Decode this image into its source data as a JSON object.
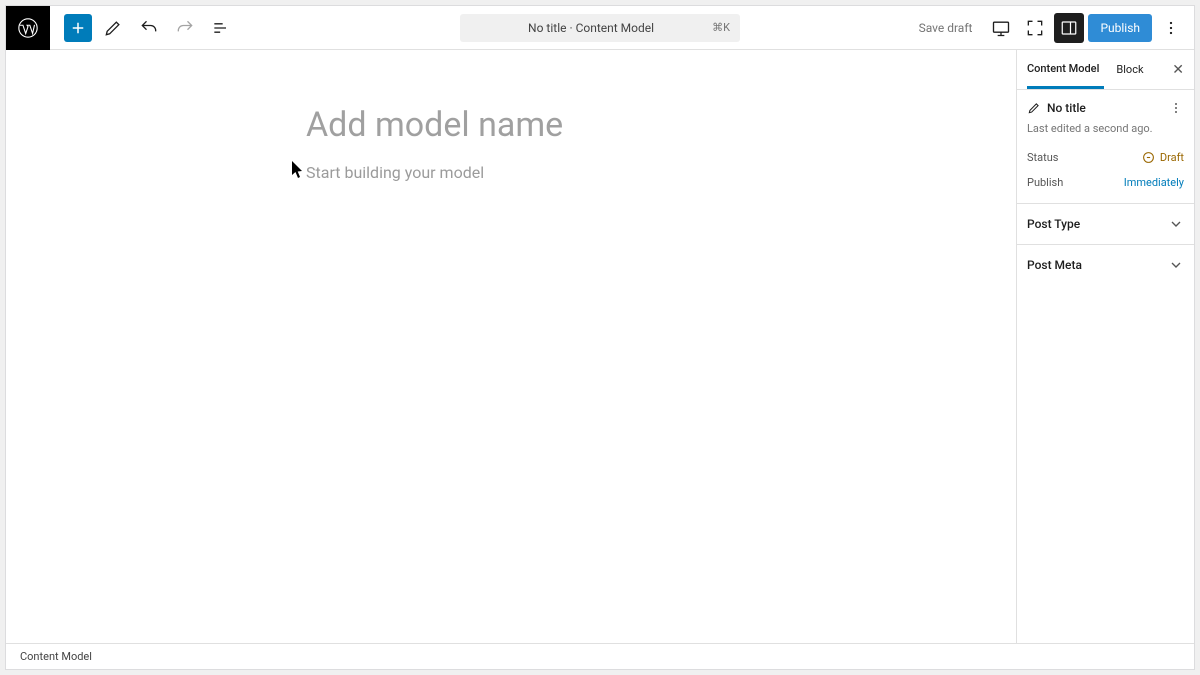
{
  "topbar": {
    "center_title": "No title · Content Model",
    "center_kbd": "⌘K",
    "save_draft": "Save draft",
    "publish": "Publish"
  },
  "editor": {
    "title_placeholder": "Add model name",
    "body_placeholder": "Start building your model"
  },
  "sidebar": {
    "tabs": {
      "content_model": "Content Model",
      "block": "Block"
    },
    "doc_title": "No title",
    "last_edited": "Last edited a second ago.",
    "status_label": "Status",
    "status_value": "Draft",
    "publish_label": "Publish",
    "publish_value": "Immediately",
    "sections": {
      "post_type": "Post Type",
      "post_meta": "Post Meta"
    }
  },
  "footer": {
    "breadcrumb": "Content Model"
  }
}
